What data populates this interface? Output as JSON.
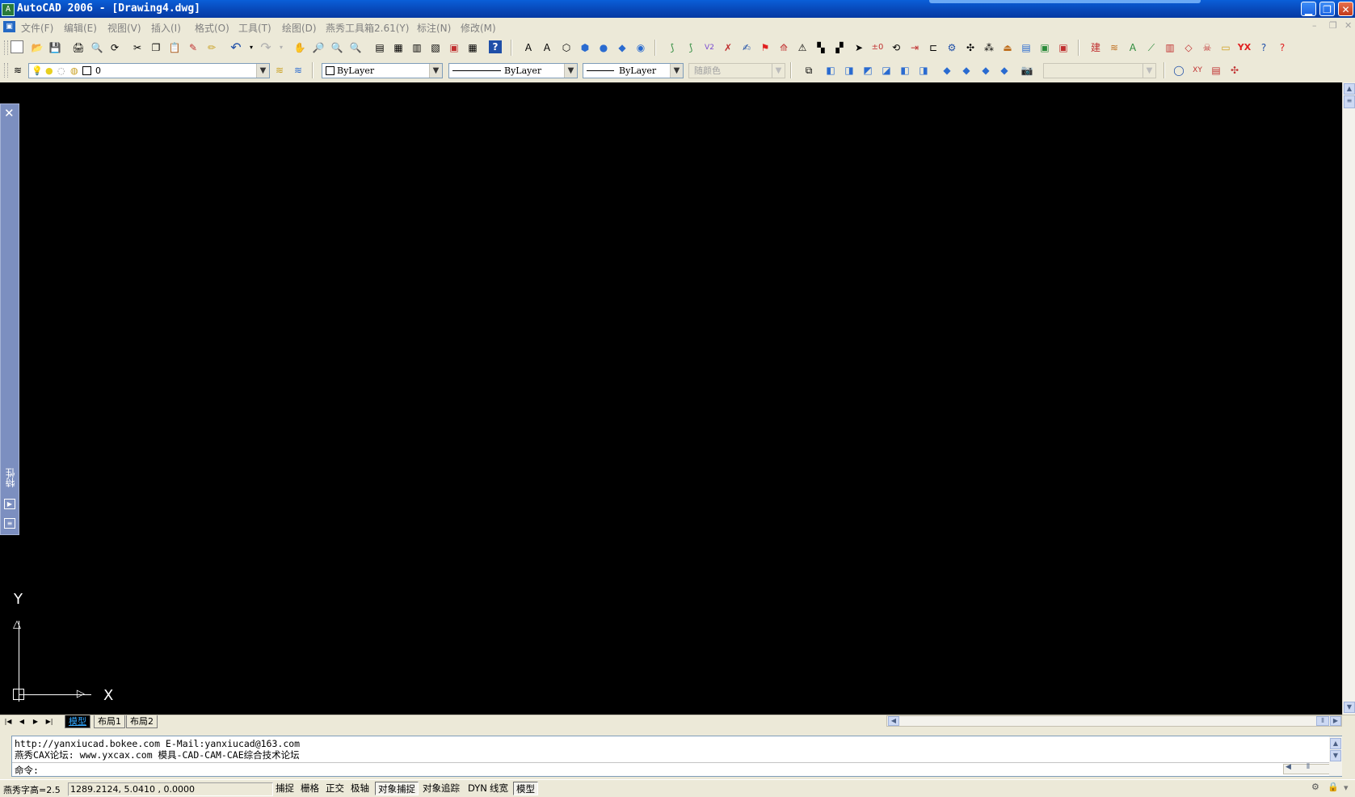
{
  "titlebar": {
    "app_icon": "autocad-app-icon",
    "title": "AutoCAD 2006 - [Drawing4.dwg]"
  },
  "menubar": {
    "items": [
      "文件(F)",
      "编辑(E)",
      "视图(V)",
      "插入(I)",
      "格式(O)",
      "工具(T)",
      "绘图(D)",
      "燕秀工具箱2.61(Y)",
      "标注(N)",
      "修改(M)"
    ]
  },
  "layers": {
    "current": "0"
  },
  "properties": {
    "color": "ByLayer",
    "linetype": "ByLayer",
    "lineweight": "ByLayer",
    "plotstyle": "随颜色"
  },
  "palette": {
    "label": "特性"
  },
  "ucs": {
    "x_label": "X",
    "y_label": "Y"
  },
  "tabs": {
    "model": "模型",
    "layout1": "布局1",
    "layout2": "布局2"
  },
  "command": {
    "line1": "http://yanxiucad.bokee.com     E-Mail:yanxiucad@163.com",
    "line2": "燕秀CAX论坛: www.yxcax.com     模具-CAD-CAM-CAE综合技术论坛",
    "prompt": "命令:"
  },
  "status": {
    "text_height": "燕秀字高=2.5",
    "coords": "1289.2124, 5.0410  , 0.0000",
    "buttons": [
      "捕捉",
      "栅格",
      "正交",
      "极轴",
      "对象捕捉",
      "对象追踪",
      "DYN",
      "线宽",
      "模型"
    ]
  },
  "colors": {
    "canvas": "#000000",
    "titlebar": "#0a5fd8",
    "chrome": "#ece9d8",
    "active_tab_text": "#32a8ff"
  }
}
